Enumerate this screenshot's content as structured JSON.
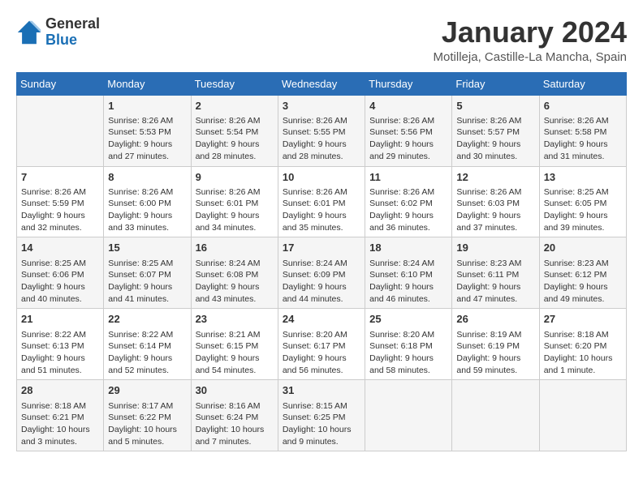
{
  "header": {
    "logo_general": "General",
    "logo_blue": "Blue",
    "title": "January 2024",
    "location": "Motilleja, Castille-La Mancha, Spain"
  },
  "days_of_week": [
    "Sunday",
    "Monday",
    "Tuesday",
    "Wednesday",
    "Thursday",
    "Friday",
    "Saturday"
  ],
  "weeks": [
    [
      {
        "day": "",
        "content": ""
      },
      {
        "day": "1",
        "content": "Sunrise: 8:26 AM\nSunset: 5:53 PM\nDaylight: 9 hours\nand 27 minutes."
      },
      {
        "day": "2",
        "content": "Sunrise: 8:26 AM\nSunset: 5:54 PM\nDaylight: 9 hours\nand 28 minutes."
      },
      {
        "day": "3",
        "content": "Sunrise: 8:26 AM\nSunset: 5:55 PM\nDaylight: 9 hours\nand 28 minutes."
      },
      {
        "day": "4",
        "content": "Sunrise: 8:26 AM\nSunset: 5:56 PM\nDaylight: 9 hours\nand 29 minutes."
      },
      {
        "day": "5",
        "content": "Sunrise: 8:26 AM\nSunset: 5:57 PM\nDaylight: 9 hours\nand 30 minutes."
      },
      {
        "day": "6",
        "content": "Sunrise: 8:26 AM\nSunset: 5:58 PM\nDaylight: 9 hours\nand 31 minutes."
      }
    ],
    [
      {
        "day": "7",
        "content": "Sunrise: 8:26 AM\nSunset: 5:59 PM\nDaylight: 9 hours\nand 32 minutes."
      },
      {
        "day": "8",
        "content": "Sunrise: 8:26 AM\nSunset: 6:00 PM\nDaylight: 9 hours\nand 33 minutes."
      },
      {
        "day": "9",
        "content": "Sunrise: 8:26 AM\nSunset: 6:01 PM\nDaylight: 9 hours\nand 34 minutes."
      },
      {
        "day": "10",
        "content": "Sunrise: 8:26 AM\nSunset: 6:01 PM\nDaylight: 9 hours\nand 35 minutes."
      },
      {
        "day": "11",
        "content": "Sunrise: 8:26 AM\nSunset: 6:02 PM\nDaylight: 9 hours\nand 36 minutes."
      },
      {
        "day": "12",
        "content": "Sunrise: 8:26 AM\nSunset: 6:03 PM\nDaylight: 9 hours\nand 37 minutes."
      },
      {
        "day": "13",
        "content": "Sunrise: 8:25 AM\nSunset: 6:05 PM\nDaylight: 9 hours\nand 39 minutes."
      }
    ],
    [
      {
        "day": "14",
        "content": "Sunrise: 8:25 AM\nSunset: 6:06 PM\nDaylight: 9 hours\nand 40 minutes."
      },
      {
        "day": "15",
        "content": "Sunrise: 8:25 AM\nSunset: 6:07 PM\nDaylight: 9 hours\nand 41 minutes."
      },
      {
        "day": "16",
        "content": "Sunrise: 8:24 AM\nSunset: 6:08 PM\nDaylight: 9 hours\nand 43 minutes."
      },
      {
        "day": "17",
        "content": "Sunrise: 8:24 AM\nSunset: 6:09 PM\nDaylight: 9 hours\nand 44 minutes."
      },
      {
        "day": "18",
        "content": "Sunrise: 8:24 AM\nSunset: 6:10 PM\nDaylight: 9 hours\nand 46 minutes."
      },
      {
        "day": "19",
        "content": "Sunrise: 8:23 AM\nSunset: 6:11 PM\nDaylight: 9 hours\nand 47 minutes."
      },
      {
        "day": "20",
        "content": "Sunrise: 8:23 AM\nSunset: 6:12 PM\nDaylight: 9 hours\nand 49 minutes."
      }
    ],
    [
      {
        "day": "21",
        "content": "Sunrise: 8:22 AM\nSunset: 6:13 PM\nDaylight: 9 hours\nand 51 minutes."
      },
      {
        "day": "22",
        "content": "Sunrise: 8:22 AM\nSunset: 6:14 PM\nDaylight: 9 hours\nand 52 minutes."
      },
      {
        "day": "23",
        "content": "Sunrise: 8:21 AM\nSunset: 6:15 PM\nDaylight: 9 hours\nand 54 minutes."
      },
      {
        "day": "24",
        "content": "Sunrise: 8:20 AM\nSunset: 6:17 PM\nDaylight: 9 hours\nand 56 minutes."
      },
      {
        "day": "25",
        "content": "Sunrise: 8:20 AM\nSunset: 6:18 PM\nDaylight: 9 hours\nand 58 minutes."
      },
      {
        "day": "26",
        "content": "Sunrise: 8:19 AM\nSunset: 6:19 PM\nDaylight: 9 hours\nand 59 minutes."
      },
      {
        "day": "27",
        "content": "Sunrise: 8:18 AM\nSunset: 6:20 PM\nDaylight: 10 hours\nand 1 minute."
      }
    ],
    [
      {
        "day": "28",
        "content": "Sunrise: 8:18 AM\nSunset: 6:21 PM\nDaylight: 10 hours\nand 3 minutes."
      },
      {
        "day": "29",
        "content": "Sunrise: 8:17 AM\nSunset: 6:22 PM\nDaylight: 10 hours\nand 5 minutes."
      },
      {
        "day": "30",
        "content": "Sunrise: 8:16 AM\nSunset: 6:24 PM\nDaylight: 10 hours\nand 7 minutes."
      },
      {
        "day": "31",
        "content": "Sunrise: 8:15 AM\nSunset: 6:25 PM\nDaylight: 10 hours\nand 9 minutes."
      },
      {
        "day": "",
        "content": ""
      },
      {
        "day": "",
        "content": ""
      },
      {
        "day": "",
        "content": ""
      }
    ]
  ]
}
